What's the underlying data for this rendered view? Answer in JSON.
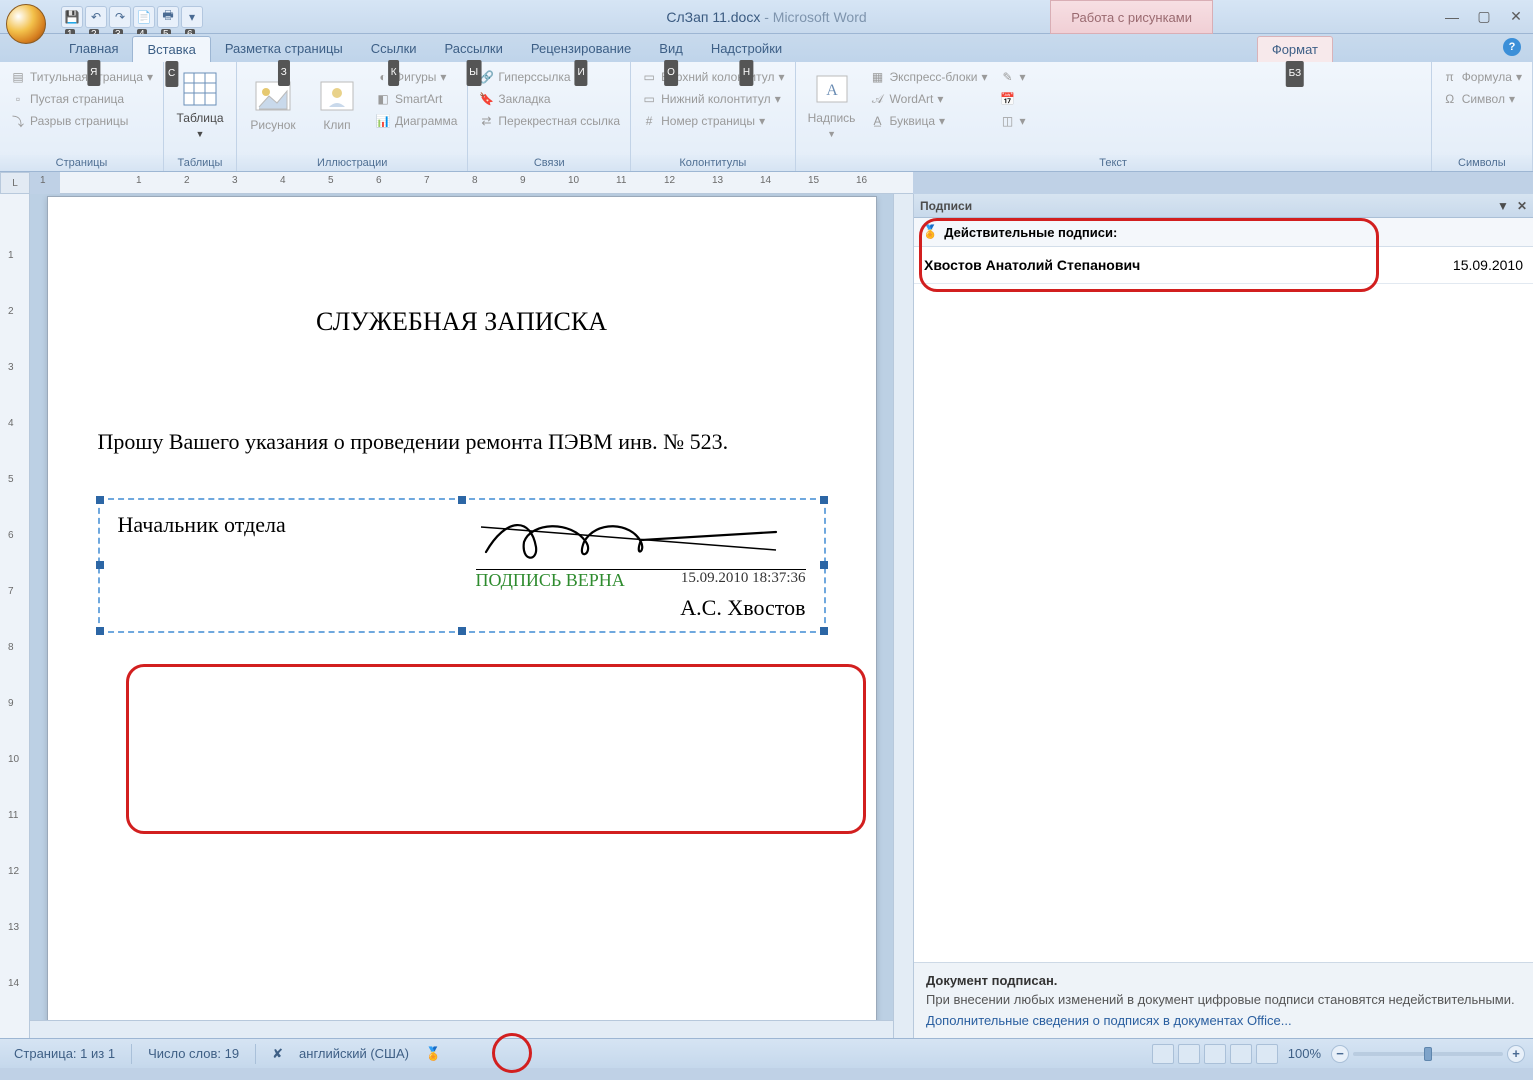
{
  "title": {
    "doc": "СлЗап 11.docx",
    "app": "Microsoft Word"
  },
  "context_title": "Работа с рисунками",
  "qat_keytips": [
    "1",
    "2",
    "3",
    "4",
    "5",
    "6"
  ],
  "tabs": {
    "items": [
      {
        "label": "Главная",
        "key": "Я"
      },
      {
        "label": "Вставка",
        "key": "С",
        "active": true
      },
      {
        "label": "Разметка страницы",
        "key": "З"
      },
      {
        "label": "Ссылки",
        "key": "К"
      },
      {
        "label": "Рассылки",
        "key": "Ы"
      },
      {
        "label": "Рецензирование",
        "key": "И"
      },
      {
        "label": "Вид",
        "key": "О"
      },
      {
        "label": "Надстройки",
        "key": "Н"
      }
    ],
    "context": {
      "label": "Формат",
      "key": "БЗ"
    }
  },
  "ribbon": {
    "pages": {
      "label": "Страницы",
      "cover": "Титульная страница",
      "blank": "Пустая страница",
      "break": "Разрыв страницы"
    },
    "tables": {
      "label": "Таблицы",
      "btn": "Таблица"
    },
    "illus": {
      "label": "Иллюстрации",
      "pic": "Рисунок",
      "clip": "Клип",
      "shapes": "Фигуры",
      "smartart": "SmartArt",
      "chart": "Диаграмма"
    },
    "links": {
      "label": "Связи",
      "hyper": "Гиперссылка",
      "bookmark": "Закладка",
      "xref": "Перекрестная ссылка"
    },
    "hf": {
      "label": "Колонтитулы",
      "header": "Верхний колонтитул",
      "footer": "Нижний колонтитул",
      "pageno": "Номер страницы"
    },
    "text": {
      "label": "Текст",
      "textbox": "Надпись",
      "quick": "Экспресс-блоки",
      "wordart": "WordArt",
      "dropcap": "Буквица"
    },
    "symbols": {
      "label": "Символы",
      "equation": "Формула",
      "symbol": "Символ"
    }
  },
  "ruler_h": [
    "1",
    "",
    "1",
    "2",
    "3",
    "4",
    "5",
    "6",
    "7",
    "8",
    "9",
    "10",
    "11",
    "12",
    "13",
    "14",
    "15",
    "16"
  ],
  "ruler_v": [
    "",
    "1",
    "2",
    "3",
    "4",
    "5",
    "6",
    "7",
    "8",
    "9",
    "10",
    "11",
    "12",
    "13",
    "14"
  ],
  "document": {
    "title": "СЛУЖЕБНАЯ ЗАПИСКА",
    "body": "Прошу Вашего указания о проведении ремонта ПЭВМ инв. № 523.",
    "sig_role": "Начальник отдела",
    "sig_valid": "ПОДПИСЬ ВЕРНА",
    "sig_timestamp": "15.09.2010 18:37:36",
    "sig_name": "А.С. Хвостов"
  },
  "sigpane": {
    "title": "Подписи",
    "valid_header": "Действительные подписи:",
    "signer": "Хвостов Анатолий Степанович",
    "date": "15.09.2010",
    "footer_bold": "Документ подписан.",
    "footer_text": "При внесении любых изменений в документ цифровые подписи становятся недействительными.",
    "footer_link": "Дополнительные сведения о подписях в документах Office..."
  },
  "statusbar": {
    "page": "Страница: 1 из 1",
    "words": "Число слов: 19",
    "lang": "английский (США)",
    "zoom": "100%"
  }
}
